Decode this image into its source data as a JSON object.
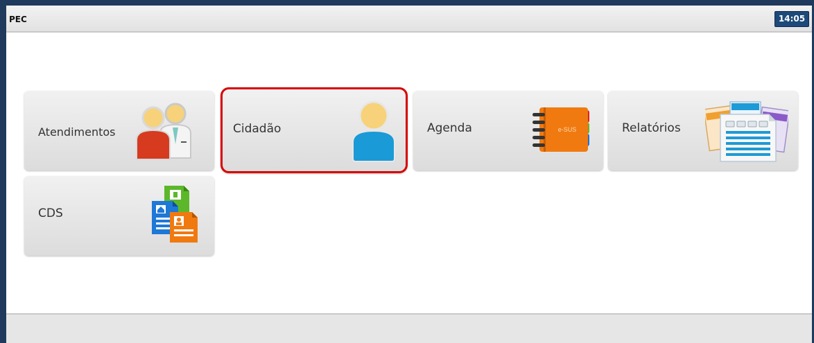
{
  "header": {
    "app_title": "PEC",
    "clock": "14:05"
  },
  "menu": {
    "tiles": [
      {
        "label": "Atendimentos",
        "icon": "professionals-icon",
        "selected": false
      },
      {
        "label": "Cidadão",
        "icon": "citizen-person-icon",
        "selected": true
      },
      {
        "label": "Agenda",
        "icon": "agenda-book-icon",
        "selected": false,
        "icon_text": "e-SUS"
      },
      {
        "label": "Relatórios",
        "icon": "reports-documents-icon",
        "selected": false
      },
      {
        "label": "CDS",
        "icon": "cds-forms-icon",
        "selected": false
      }
    ]
  },
  "colors": {
    "frame": "#1f3a5c",
    "clock_bg": "#1c4a7a",
    "selection_border": "#d90000",
    "tile_bg": "#e6e6e6"
  }
}
